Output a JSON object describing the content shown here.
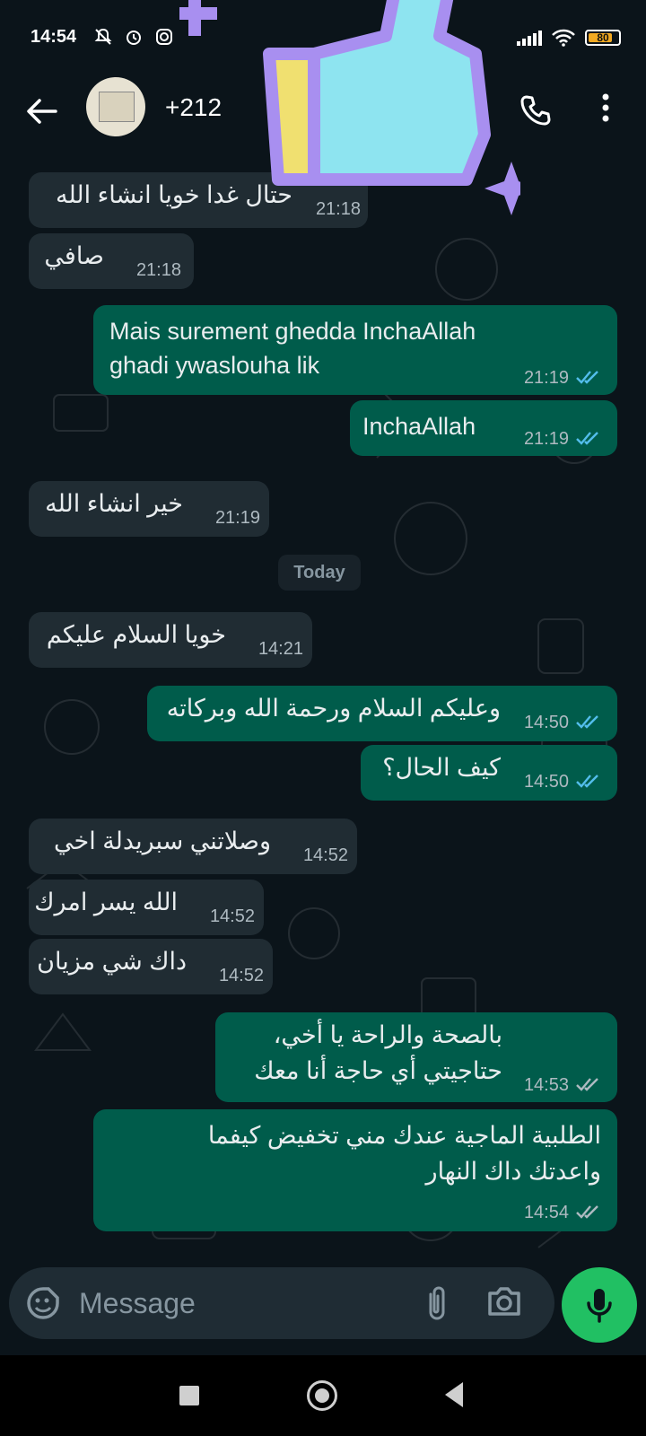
{
  "status_bar": {
    "time": "14:54",
    "battery": "80",
    "battery_level": 0.8,
    "icons_left": [
      "mute-icon",
      "alarm-icon",
      "instagram-icon"
    ],
    "icons_right": [
      "signal-icon",
      "wifi-icon",
      "battery-icon"
    ]
  },
  "header": {
    "contact_name": "+212",
    "icons": [
      "back-arrow-icon",
      "avatar",
      "call-icon",
      "more-icon"
    ]
  },
  "date_separator": "Today",
  "messages": [
    {
      "dir": "in",
      "text": "حتال غدا خويا انشاء الله",
      "time": "21:18"
    },
    {
      "dir": "in",
      "text": "صافي",
      "time": "21:18"
    },
    {
      "dir": "out",
      "lines": [
        "Mais surement ghedda InchaAllah",
        "ghadi ywaslouha lik"
      ],
      "time": "21:19",
      "ticks": "read"
    },
    {
      "dir": "out",
      "text": "InchaAllah",
      "time": "21:19",
      "ticks": "read"
    },
    {
      "dir": "in",
      "text": "خير انشاء الله",
      "time": "21:19"
    },
    {
      "dir": "in",
      "text": "خويا السلام عليكم",
      "time": "14:21"
    },
    {
      "dir": "out",
      "text": "وعليكم السلام ورحمة الله وبركاته",
      "time": "14:50",
      "ticks": "read"
    },
    {
      "dir": "out",
      "text": "كيف الحال؟",
      "time": "14:50",
      "ticks": "read"
    },
    {
      "dir": "in",
      "text": "وصلاتني سبريدلة اخي",
      "time": "14:52"
    },
    {
      "dir": "in",
      "text": "الله يسر امرك",
      "time": "14:52"
    },
    {
      "dir": "in",
      "text": "داك شي مزيان",
      "time": "14:52"
    },
    {
      "dir": "out",
      "lines": [
        "بالصحة والراحة يا أخي،",
        "حتاجيتي أي حاجة أنا معك"
      ],
      "time": "14:53",
      "ticks": "delivered"
    },
    {
      "dir": "out",
      "lines": [
        "الطلبية الماجية عندك مني تخفيض كيفما",
        "واعدتك داك النهار"
      ],
      "time": "14:54",
      "ticks": "delivered"
    }
  ],
  "input": {
    "placeholder": "Message",
    "icons": [
      "emoji-icon",
      "attach-icon",
      "camera-icon",
      "mic-icon"
    ]
  },
  "colors": {
    "background": "#0b141a",
    "incoming_bubble": "#202c33",
    "outgoing_bubble": "#005c4b",
    "read_ticks": "#53bdeb",
    "delivered_ticks": "#aebac1",
    "mic_button": "#21c063",
    "sticker_fill": "#8ee4f0",
    "sticker_outline": "#a88ff0",
    "sticker_accent": "#f0e070"
  }
}
